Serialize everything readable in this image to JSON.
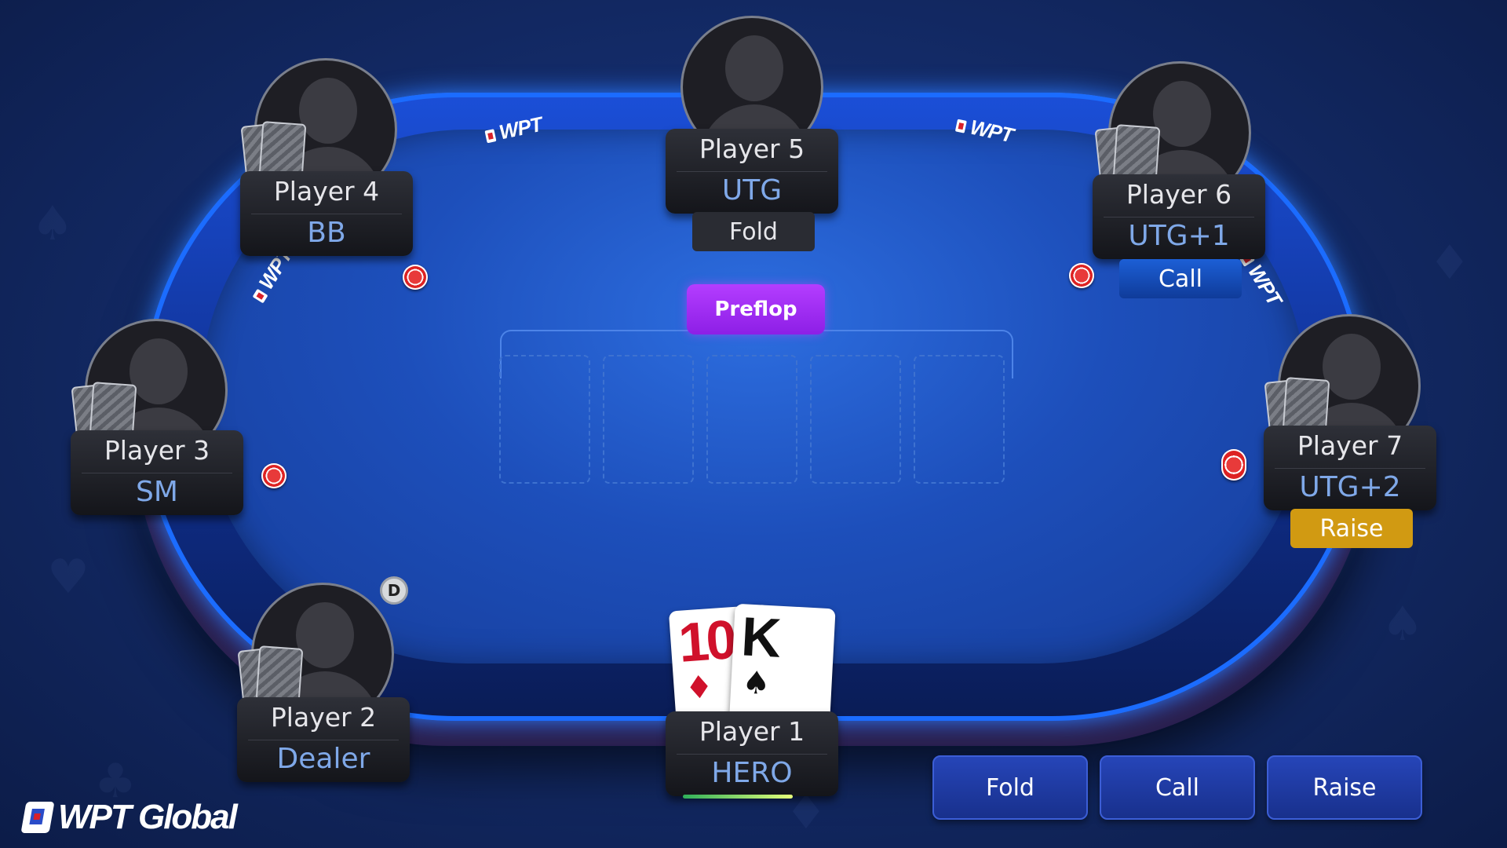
{
  "table": {
    "rail_logo": "WPT",
    "street": "Preflop"
  },
  "seats": [
    {
      "name": "Player 1",
      "position": "HERO"
    },
    {
      "name": "Player 2",
      "position": "Dealer"
    },
    {
      "name": "Player 3",
      "position": "SM"
    },
    {
      "name": "Player 4",
      "position": "BB"
    },
    {
      "name": "Player 5",
      "position": "UTG",
      "action": "Fold"
    },
    {
      "name": "Player 6",
      "position": "UTG+1",
      "action": "Call"
    },
    {
      "name": "Player 7",
      "position": "UTG+2",
      "action": "Raise"
    }
  ],
  "dealer_button": "D",
  "hero_cards": [
    {
      "rank": "10",
      "suit": "♦",
      "color": "#d0112b"
    },
    {
      "rank": "K",
      "suit": "♠",
      "color": "#111111"
    }
  ],
  "action_buttons": {
    "fold": "Fold",
    "call": "Call",
    "raise": "Raise"
  },
  "brand": {
    "name": "WPT Global"
  },
  "colors": {
    "accent": "#1b6cff",
    "street_badge": "#b43dff",
    "raise_tag": "#d19a12",
    "call_tag": "#1c5fd6"
  }
}
